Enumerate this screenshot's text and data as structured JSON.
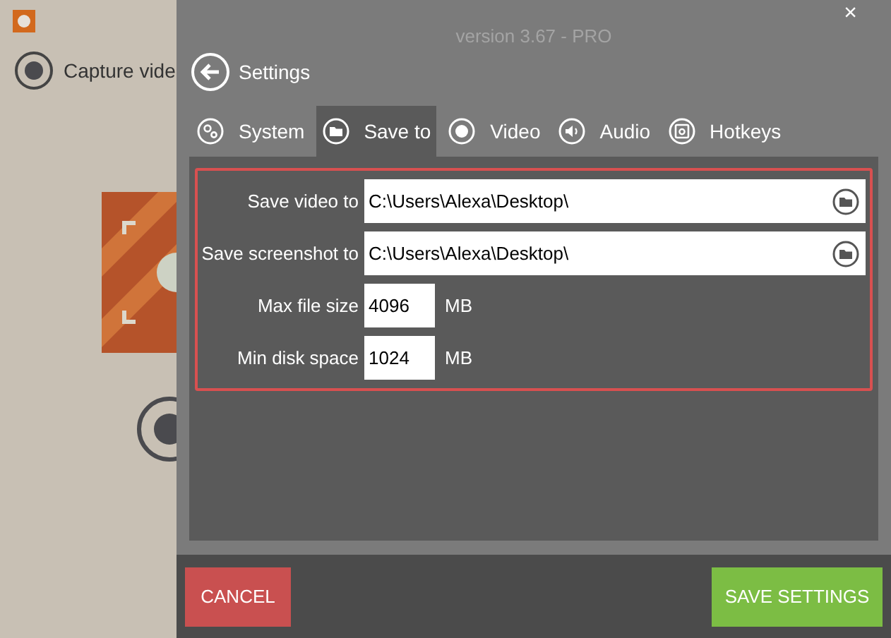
{
  "app": {
    "capture_label": "Capture vide"
  },
  "window": {
    "version": "version 3.67 - PRO",
    "close": "×"
  },
  "header": {
    "title": "Settings"
  },
  "tabs": [
    {
      "label": "System",
      "kind": "gears",
      "selected": false
    },
    {
      "label": "Save to",
      "kind": "folder",
      "selected": true
    },
    {
      "label": "Video",
      "kind": "record",
      "selected": false
    },
    {
      "label": "Audio",
      "kind": "speaker",
      "selected": false
    },
    {
      "label": "Hotkeys",
      "kind": "key",
      "selected": false
    }
  ],
  "fields": [
    {
      "label": "Save video to",
      "kind": "path",
      "value": "C:\\Users\\Alexa\\Desktop\\"
    },
    {
      "label": "Save screenshot to",
      "kind": "path",
      "value": "C:\\Users\\Alexa\\Desktop\\"
    },
    {
      "label": "Max file size",
      "kind": "number",
      "value": "4096",
      "unit": "MB"
    },
    {
      "label": "Min disk space",
      "kind": "number",
      "value": "1024",
      "unit": "MB"
    }
  ],
  "buttons": {
    "cancel": "CANCEL",
    "save": "SAVE SETTINGS"
  }
}
